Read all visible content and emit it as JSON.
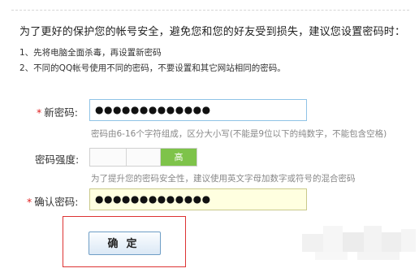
{
  "intro_text": "为了更好的保护您的帐号安全，避免您和您的好友受到损失，建议您设置密码时：",
  "tips": [
    "1、先将电脑全面杀毒，再设置新密码",
    "2、不同的QQ帐号使用不同的密码，不要设置和其它网站相同的密码。"
  ],
  "new_password": {
    "required_mark": "*",
    "label": "新密码:",
    "value": "●●●●●●●●●●●●●",
    "hint": "密码由6-16个字符组成，区分大小写(不能是9位以下的纯数字，不能包含空格)"
  },
  "strength": {
    "label": "密码强度:",
    "level_text": "高",
    "level_fraction": 1.0,
    "hint": "为了提升您的密码安全性，建议使用英文字母加数字或符号的混合密码"
  },
  "confirm_password": {
    "required_mark": "*",
    "label": "确认密码:",
    "value": "●●●●●●●●●●●●●"
  },
  "submit_button": {
    "label": "确定"
  },
  "colors": {
    "strength_high": "#7ec34a",
    "highlight_border": "#dd3333",
    "required": "#e02020",
    "input_border": "#8fc3e6",
    "confirm_bg": "#ffffe0"
  }
}
